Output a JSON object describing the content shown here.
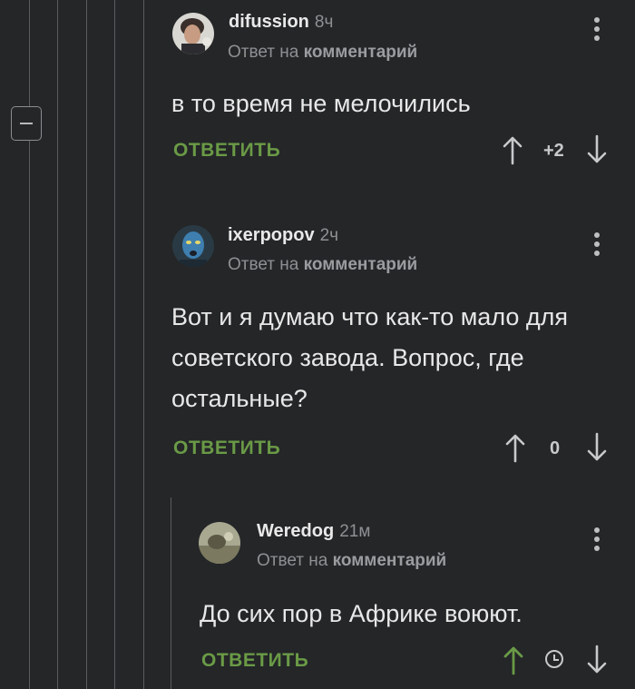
{
  "comments": [
    {
      "author": "difussion",
      "time": "8ч",
      "reply_prefix": "Ответ на",
      "reply_link": "комментарий",
      "text": "в то время не мелочились",
      "reply_label": "ОТВЕТИТЬ",
      "rating": "+2"
    },
    {
      "author": "ixerpopov",
      "time": "2ч",
      "reply_prefix": "Ответ на",
      "reply_link": "комментарий",
      "text": "Вот и я думаю что как-то мало для советского завода. Вопрос, где остальные?",
      "reply_label": "ОТВЕТИТЬ",
      "rating": "0"
    },
    {
      "author": "Weredog",
      "time": "21м",
      "reply_prefix": "Ответ на",
      "reply_link": "комментарий",
      "text": "До сих пор в Африке воюют.",
      "reply_label": "ОТВЕТИТЬ",
      "rating_state": "pending"
    }
  ],
  "colors": {
    "background": "#242628",
    "reply_green": "#6a9a46",
    "upvoted_green": "#6a9a46",
    "muted": "#8e9093"
  },
  "icons": [
    "collapse-icon",
    "more-vertical-icon",
    "arrow-up-icon",
    "arrow-down-icon",
    "clock-icon"
  ]
}
